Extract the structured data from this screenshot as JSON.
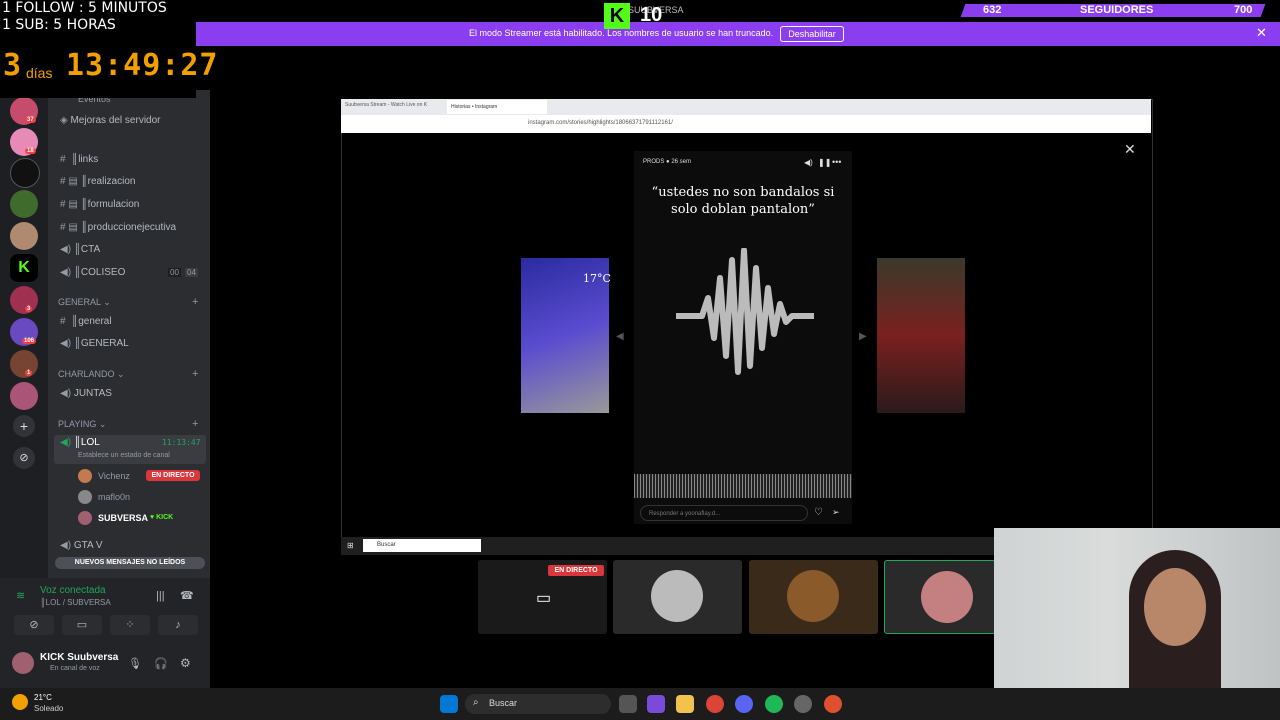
{
  "overlay": {
    "follow_line": "1 FOLLOW : 5 MINUTOS",
    "sub_line": "1 SUB: 5 HORAS",
    "days_num": "3",
    "days_label": "días",
    "clock": "13:49:27"
  },
  "kick_header": {
    "logo": "K",
    "viewers": "10",
    "name": "SUUBVERSA"
  },
  "followers_goal": {
    "current": "632",
    "label": "SEGUIDORES",
    "goal": "700",
    "color": "#8a3ef0"
  },
  "streamer_bar": {
    "message": "El modo Streamer está habilitado. Los nombres de usuario se han truncado.",
    "button": "Deshabilitar",
    "color": "#8a3ef0"
  },
  "server_badges": [
    "37",
    "18",
    "3",
    "106",
    "1"
  ],
  "channels_top": {
    "events": "Eventos",
    "boosts": "Mejoras del servidor",
    "links": "║links",
    "realizacion": "║realizacion",
    "formulacion": "║formulacion",
    "produccion": "║produccionejecutiva",
    "cta": "║CTA",
    "coliseo": "║COLISEO",
    "coliseo_count_a": "00",
    "coliseo_count_b": "04"
  },
  "categories": {
    "general": "GENERAL",
    "charlando": "CHARLANDO",
    "playing": "PLAYING"
  },
  "general_channels": {
    "text": "║general",
    "voice": "║GENERAL"
  },
  "charlando_channels": {
    "juntas": "JUNTAS"
  },
  "playing": {
    "lol": "║LOL",
    "lol_time": "11:13:47",
    "status_placeholder": "Establece un estado de canal",
    "members": [
      {
        "name": "Vichenz",
        "live": "EN DIRECTO"
      },
      {
        "name": "maflo0n",
        "live": ""
      },
      {
        "name": "SUBVERSA",
        "live": "KICK"
      }
    ],
    "gtav": "GTA V"
  },
  "new_messages": "NUEVOS MENSAJES NO LEÍDOS",
  "voice": {
    "status": "Voz conectada",
    "channel": "║LOL / SUBVERSA"
  },
  "user": {
    "name": "KICK Suubversa",
    "status": "En canal de voz"
  },
  "weather": {
    "temp": "21°C",
    "desc": "Soleado"
  },
  "taskbar": {
    "search": "Buscar"
  },
  "browser": {
    "tab1": "Suubversa Stream - Watch Live on K",
    "tab2": "Historias • Instagram",
    "url": "instagram.com/stories/highlights/18066371791112161/",
    "inner_search": "Buscar"
  },
  "story": {
    "user": "PRODS",
    "age": "26 sem",
    "quote": "“ustedes no son bandalos si solo doblan pantalon”",
    "reply_placeholder": "Responder a yoonaflay.d...",
    "prev_temp": "17°C"
  },
  "tiles": {
    "live_label": "EN DIRECTO"
  }
}
